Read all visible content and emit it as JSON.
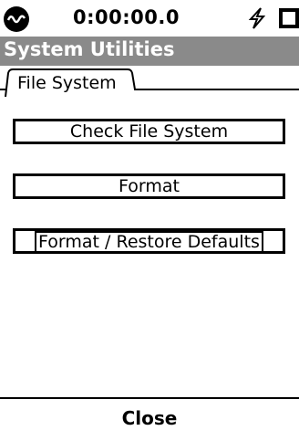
{
  "status": {
    "clock": "0:00:00.0",
    "icons": [
      "app-logo-icon",
      "lightning-bolt-icon",
      "battery-icon"
    ]
  },
  "title_bar": {
    "title": "System Utilities"
  },
  "tabs": [
    {
      "label": "File System",
      "selected": true
    }
  ],
  "buttons": {
    "check_file_system": "Check File System",
    "format": "Format",
    "format_restore_defaults": "Format / Restore Defaults"
  },
  "footer": {
    "close_label": "Close"
  },
  "colors": {
    "title_bar_bg": "#8a8a8a",
    "title_text": "#ffffff",
    "foreground": "#000000",
    "background": "#ffffff"
  }
}
